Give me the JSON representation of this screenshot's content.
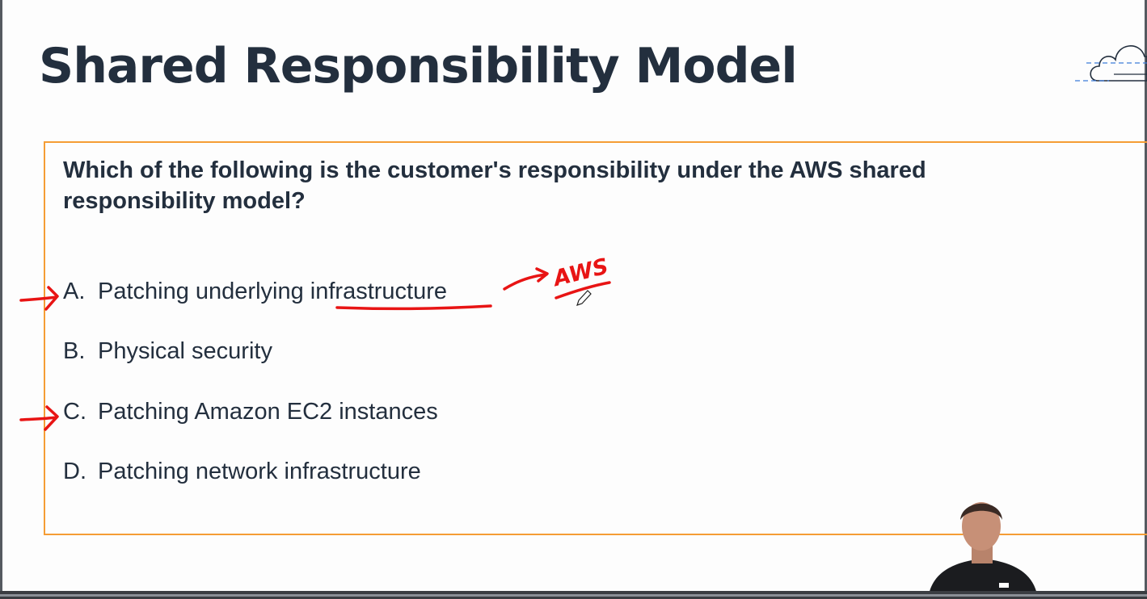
{
  "slide": {
    "title": "Shared Responsibility Model"
  },
  "question": {
    "text": "Which of the following is the customer's responsibility under the AWS shared responsibility model?",
    "options": [
      {
        "letter": "A.",
        "pre": "Patching underlying ",
        "post": "infrastructure"
      },
      {
        "letter": "B.",
        "text": "Physical security"
      },
      {
        "letter": "C.",
        "text": "Patching Amazon EC2 instances"
      },
      {
        "letter": "D.",
        "text": "Patching network infrastructure"
      }
    ]
  },
  "annotations": {
    "handwritten_note": "AWS",
    "ink_color": "#e81414",
    "marked_options": [
      "A.",
      "C."
    ]
  },
  "icons": {
    "corner": "cloud-icon",
    "pen_cursor": "pencil-cursor-icon"
  },
  "colors": {
    "title": "#232f3e",
    "box_border": "#f59d35",
    "ink": "#e81414"
  }
}
